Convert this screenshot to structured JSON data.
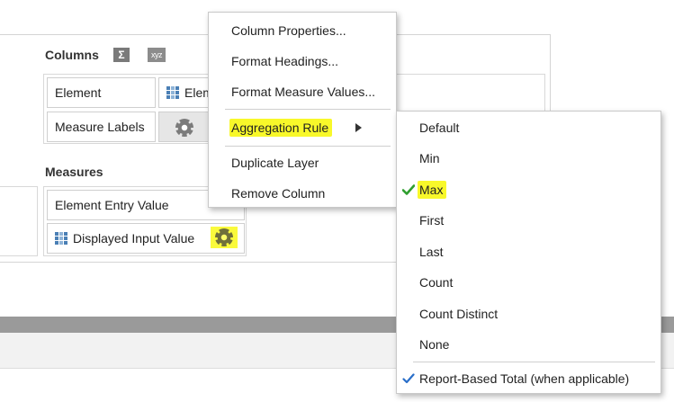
{
  "columns": {
    "title": "Columns",
    "sigma_icon": "sigma-icon",
    "xyz_label": "xyz",
    "rows": [
      {
        "label": "Element",
        "value": "Element"
      },
      {
        "label": "Measure Labels"
      }
    ]
  },
  "measures": {
    "title": "Measures",
    "rows": [
      {
        "label": "Element Entry Value"
      },
      {
        "label": "Displayed Input Value"
      }
    ]
  },
  "context_menu": {
    "items": [
      {
        "label": "Column Properties..."
      },
      {
        "label": "Format Headings..."
      },
      {
        "label": "Format Measure Values..."
      },
      {
        "label": "Aggregation Rule",
        "highlighted": true,
        "has_submenu": true
      },
      {
        "label": "Duplicate Layer"
      },
      {
        "label": "Remove Column"
      }
    ]
  },
  "aggregation_submenu": {
    "items": [
      {
        "label": "Default"
      },
      {
        "label": "Min"
      },
      {
        "label": "Max",
        "checked": true,
        "highlighted": true
      },
      {
        "label": "First"
      },
      {
        "label": "Last"
      },
      {
        "label": "Count"
      },
      {
        "label": "Count Distinct"
      },
      {
        "label": "None"
      }
    ],
    "footer_item": {
      "label": "Report-Based Total (when applicable)",
      "checked": true
    }
  },
  "colors": {
    "highlight": "#f8f82a",
    "check_green": "#2e9e2e",
    "check_blue": "#2a6fc9"
  }
}
